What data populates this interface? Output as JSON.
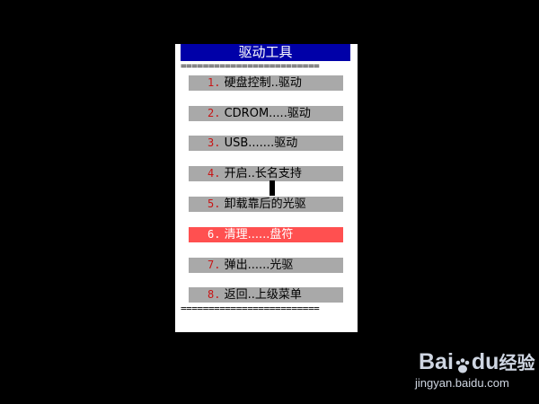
{
  "menu": {
    "title": "驱动工具",
    "separator": "=========================",
    "items": [
      {
        "num": "1.",
        "label": "硬盘控制..驱动"
      },
      {
        "num": "2.",
        "label": "CDROM.....驱动"
      },
      {
        "num": "3.",
        "label": "USB.......驱动"
      },
      {
        "num": "4.",
        "label": "开启..长名支持"
      },
      {
        "num": "5.",
        "label": "卸载靠后的光驱"
      },
      {
        "num": "6.",
        "label": "清理......盘符"
      },
      {
        "num": "7.",
        "label": "弹出......光驱"
      },
      {
        "num": "8.",
        "label": "返回..上级菜单"
      }
    ],
    "selected_index": 5
  },
  "colors": {
    "title_bar": "#0000a8",
    "item_bg": "#a9a9a9",
    "item_selected_bg": "#ff5050",
    "number_color": "#c81414"
  },
  "watermark": {
    "brand_left": "Bai",
    "brand_right": "du",
    "brand_cn": "经验",
    "url": "jingyan.baidu.com",
    "icon": "paw-icon"
  }
}
